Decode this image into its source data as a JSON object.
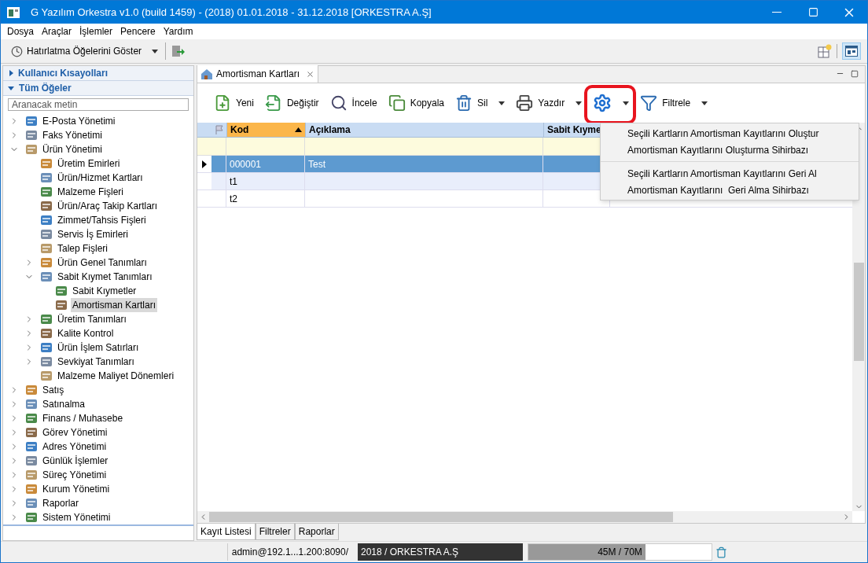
{
  "window": {
    "title": "G Yazılım Orkestra v1.0 (build 1459) - (2018) 01.01.2018 - 31.12.2018 [ORKESTRA A.Ş]"
  },
  "menu": [
    "Dosya",
    "Araçlar",
    "İşlemler",
    "Pencere",
    "Yardım"
  ],
  "toolbar": {
    "reminder_button": "Hatırlatma Öğelerini Göster"
  },
  "sidebar": {
    "sections": [
      {
        "label": "Kullanıcı Kısayolları",
        "expanded": false
      },
      {
        "label": "Tüm Öğeler",
        "expanded": true
      }
    ],
    "search": {
      "placeholder": "Aranacak metin"
    },
    "tree": [
      {
        "label": "E-Posta Yönetimi",
        "expanded": false,
        "selected": false
      },
      {
        "label": "Faks Yönetimi",
        "expanded": false,
        "selected": false
      },
      {
        "label": "Ürün Yönetimi",
        "expanded": true,
        "selected": false,
        "children": [
          {
            "label": "Üretim Emirleri",
            "selected": false
          },
          {
            "label": "Ürün/Hizmet Kartları",
            "selected": false
          },
          {
            "label": "Malzeme Fişleri",
            "selected": false
          },
          {
            "label": "Ürün/Araç Takip Kartları",
            "selected": false
          },
          {
            "label": "Zimmet/Tahsis Fişleri",
            "selected": false
          },
          {
            "label": "Servis İş Emirleri",
            "selected": false
          },
          {
            "label": "Talep Fişleri",
            "selected": false
          },
          {
            "label": "Ürün Genel Tanımları",
            "expanded": false,
            "selected": false
          },
          {
            "label": "Sabit Kıymet Tanımları",
            "expanded": true,
            "selected": false,
            "children": [
              {
                "label": "Sabit Kıymetler",
                "selected": false
              },
              {
                "label": "Amortisman Kartları",
                "selected": true
              }
            ]
          },
          {
            "label": "Üretim Tanımları",
            "expanded": false,
            "selected": false
          },
          {
            "label": "Kalite Kontrol",
            "expanded": false,
            "selected": false
          },
          {
            "label": "Ürün İşlem Satırları",
            "expanded": false,
            "selected": false
          },
          {
            "label": "Sevkiyat Tanımları",
            "expanded": false,
            "selected": false
          },
          {
            "label": "Malzeme Maliyet Dönemleri",
            "selected": false
          }
        ]
      },
      {
        "label": "Satış",
        "expanded": false,
        "selected": false
      },
      {
        "label": "Satınalma",
        "expanded": false,
        "selected": false
      },
      {
        "label": "Finans / Muhasebe",
        "expanded": false,
        "selected": false
      },
      {
        "label": "Görev Yönetimi",
        "expanded": false,
        "selected": false
      },
      {
        "label": "Adres Yönetimi",
        "expanded": false,
        "selected": false
      },
      {
        "label": "Günlük İşlemler",
        "expanded": false,
        "selected": false
      },
      {
        "label": "Süreç Yönetimi",
        "expanded": false,
        "selected": false
      },
      {
        "label": "Kurum Yönetimi",
        "expanded": false,
        "selected": false
      },
      {
        "label": "Raporlar",
        "expanded": false,
        "selected": false
      },
      {
        "label": "Sistem Yönetimi",
        "expanded": false,
        "selected": false
      }
    ]
  },
  "editor": {
    "tab": {
      "label": "Amortisman Kartları",
      "selected": true
    },
    "actions": [
      {
        "kind": "new",
        "label": "Yeni",
        "dropdown": false,
        "highlighted": false
      },
      {
        "kind": "edit",
        "label": "Değiştir",
        "dropdown": false,
        "highlighted": false
      },
      {
        "kind": "view",
        "label": "İncele",
        "dropdown": false,
        "highlighted": false
      },
      {
        "kind": "copy",
        "label": "Kopyala",
        "dropdown": false,
        "highlighted": false
      },
      {
        "kind": "delete",
        "label": "Sil",
        "dropdown": true,
        "highlighted": false
      },
      {
        "kind": "print",
        "label": "Yazdır",
        "dropdown": true,
        "highlighted": false
      },
      {
        "kind": "gear",
        "dropdown": true,
        "highlighted": true
      },
      {
        "kind": "filter",
        "label": "Filtrele",
        "dropdown": true,
        "highlighted": false
      }
    ],
    "grid": {
      "columns": [
        {
          "label": "Kod",
          "sorted": true
        },
        {
          "label": "Açıklama",
          "sorted": false
        },
        {
          "label": "Sabit Kıyme",
          "sorted": false
        }
      ],
      "rows": [
        {
          "cells": [
            "000001",
            "Test"
          ],
          "selected": true
        },
        {
          "cells": [
            "t1"
          ],
          "selected": false
        },
        {
          "cells": [
            "t2"
          ],
          "selected": false
        }
      ]
    },
    "context_menu": {
      "groups": [
        [
          "Seçili Kartların Amortisman Kayıtlarını Oluştur",
          "Amortisman Kayıtlarını Oluşturma Sihirbazı"
        ],
        [
          "Seçili Kartların Amortisman Kayıtlarını Geri Al",
          "Amortisman Kayıtlarını  Geri Alma Sihirbazı"
        ]
      ]
    },
    "bottom_tabs": [
      {
        "label": "Kayıt Listesi",
        "selected": true
      },
      {
        "label": "Filtreler",
        "selected": false
      },
      {
        "label": "Raporlar",
        "selected": false
      }
    ]
  },
  "status_bar": {
    "user": "admin@192.1...1.200:8090/",
    "company": "2018 / ORKESTRA A.Ş",
    "memory": "45M / 70M",
    "level": 0.64
  }
}
